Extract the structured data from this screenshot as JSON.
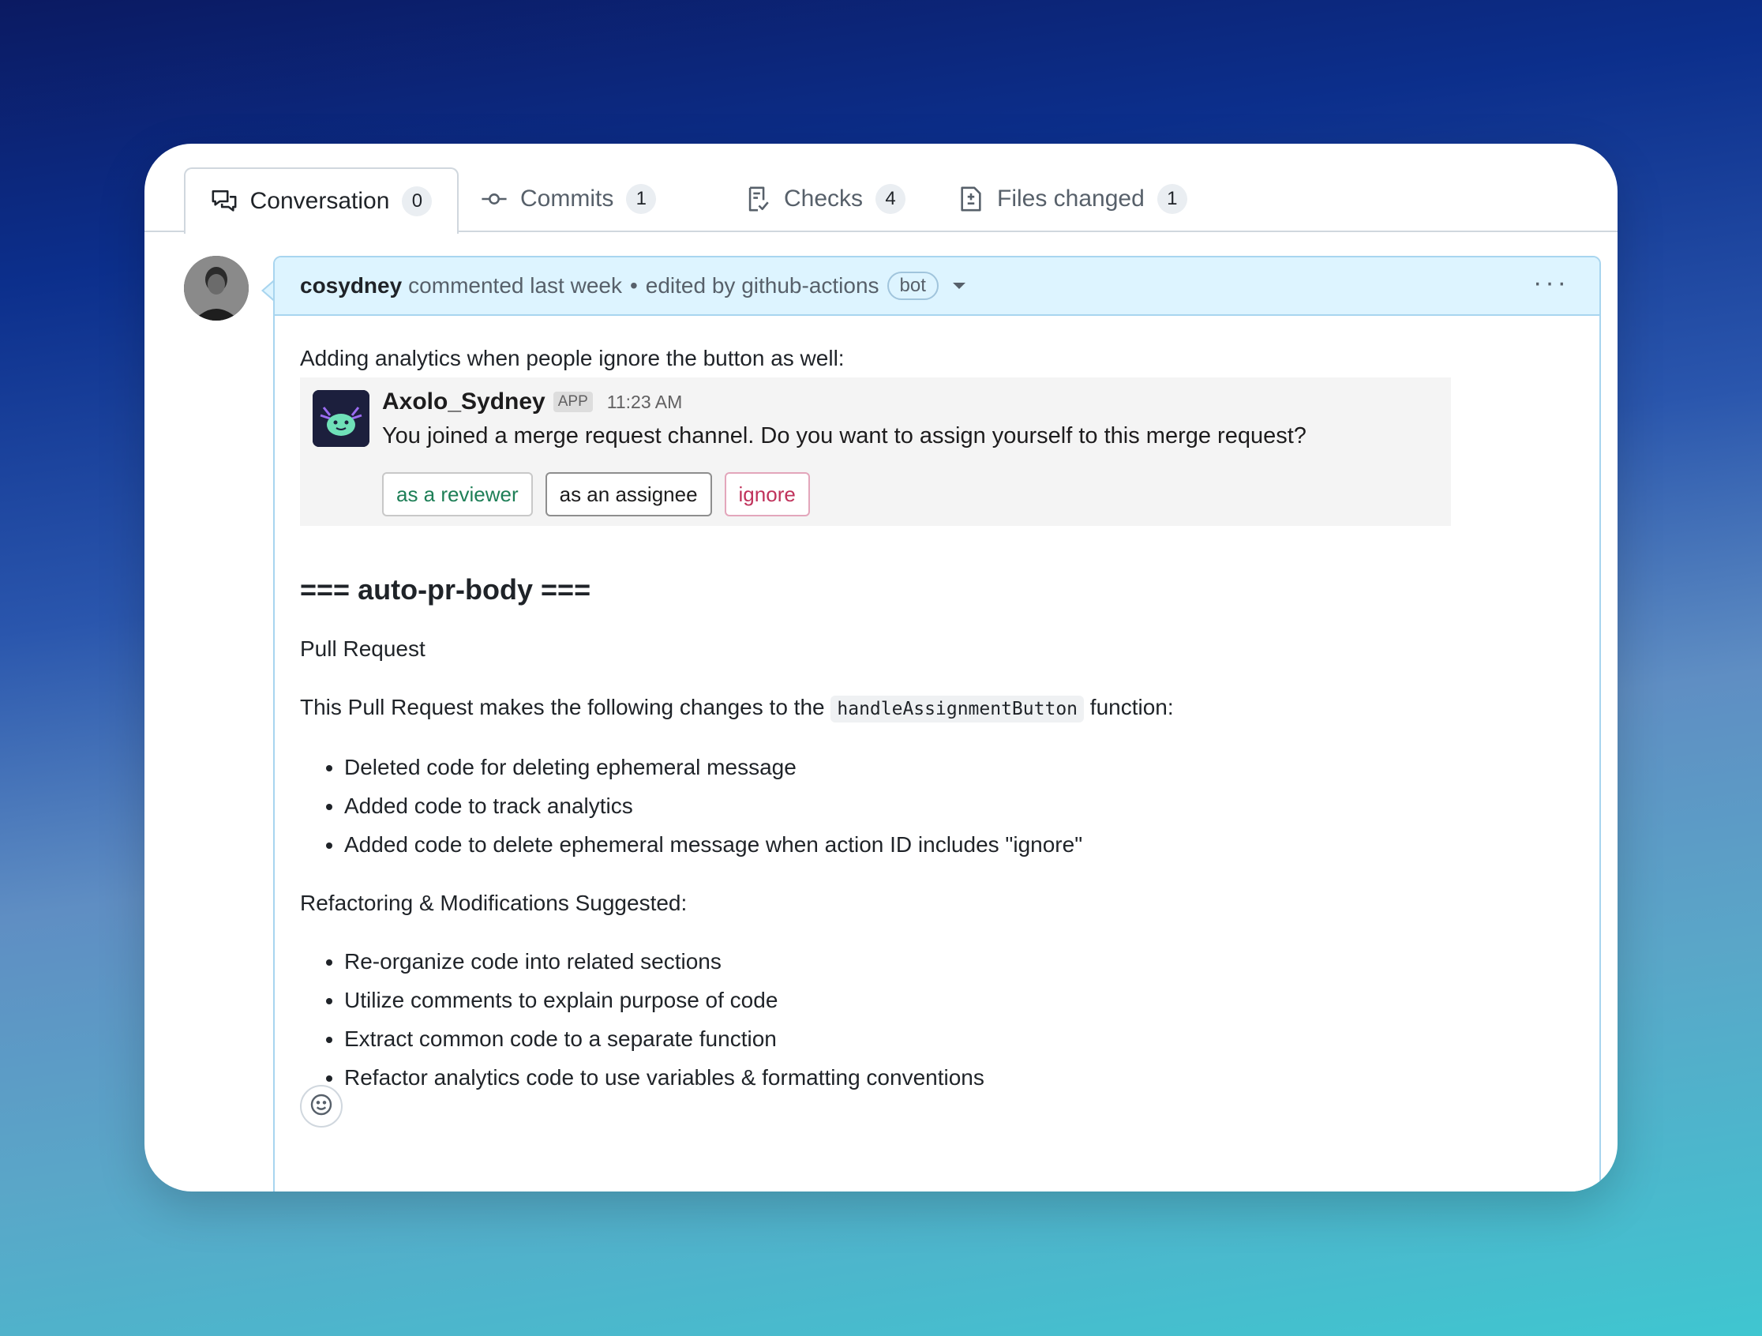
{
  "tabs": [
    {
      "label": "Conversation",
      "count": "0",
      "icon": "conversation-icon"
    },
    {
      "label": "Commits",
      "count": "1",
      "icon": "commit-icon"
    },
    {
      "label": "Checks",
      "count": "4",
      "icon": "checks-icon"
    },
    {
      "label": "Files changed",
      "count": "1",
      "icon": "file-diff-icon"
    }
  ],
  "comment": {
    "author": "cosydney",
    "action": "commented last week",
    "separator": "•",
    "edited": "edited by github-actions",
    "bot_badge": "bot",
    "more_label": "···"
  },
  "body": {
    "intro": "Adding analytics when people ignore the button as well:",
    "slack": {
      "app_name": "Axolo_Sydney",
      "app_tag": "APP",
      "time": "11:23 AM",
      "message": "You joined a merge request channel. Do you want to assign yourself to this merge request?",
      "buttons": [
        "as a reviewer",
        "as an assignee",
        "ignore"
      ]
    },
    "heading": "=== auto-pr-body ===",
    "subtitle": "Pull Request",
    "summary_before": "This Pull Request makes the following changes to the ",
    "summary_code": "handleAssignmentButton",
    "summary_after": " function:",
    "changes": [
      "Deleted code for deleting ephemeral message",
      "Added code to track analytics",
      "Added code to delete ephemeral message when action ID includes \"ignore\""
    ],
    "refactor_title": "Refactoring & Modifications Suggested:",
    "refactors": [
      "Re-organize code into related sections",
      "Utilize comments to explain purpose of code",
      "Extract common code to a separate function",
      "Refactor analytics code to use variables & formatting conventions"
    ]
  },
  "colors": {
    "header_bg": "#ddf4ff",
    "reviewer_green": "#1e7f57",
    "ignore_red": "#c0325b"
  }
}
